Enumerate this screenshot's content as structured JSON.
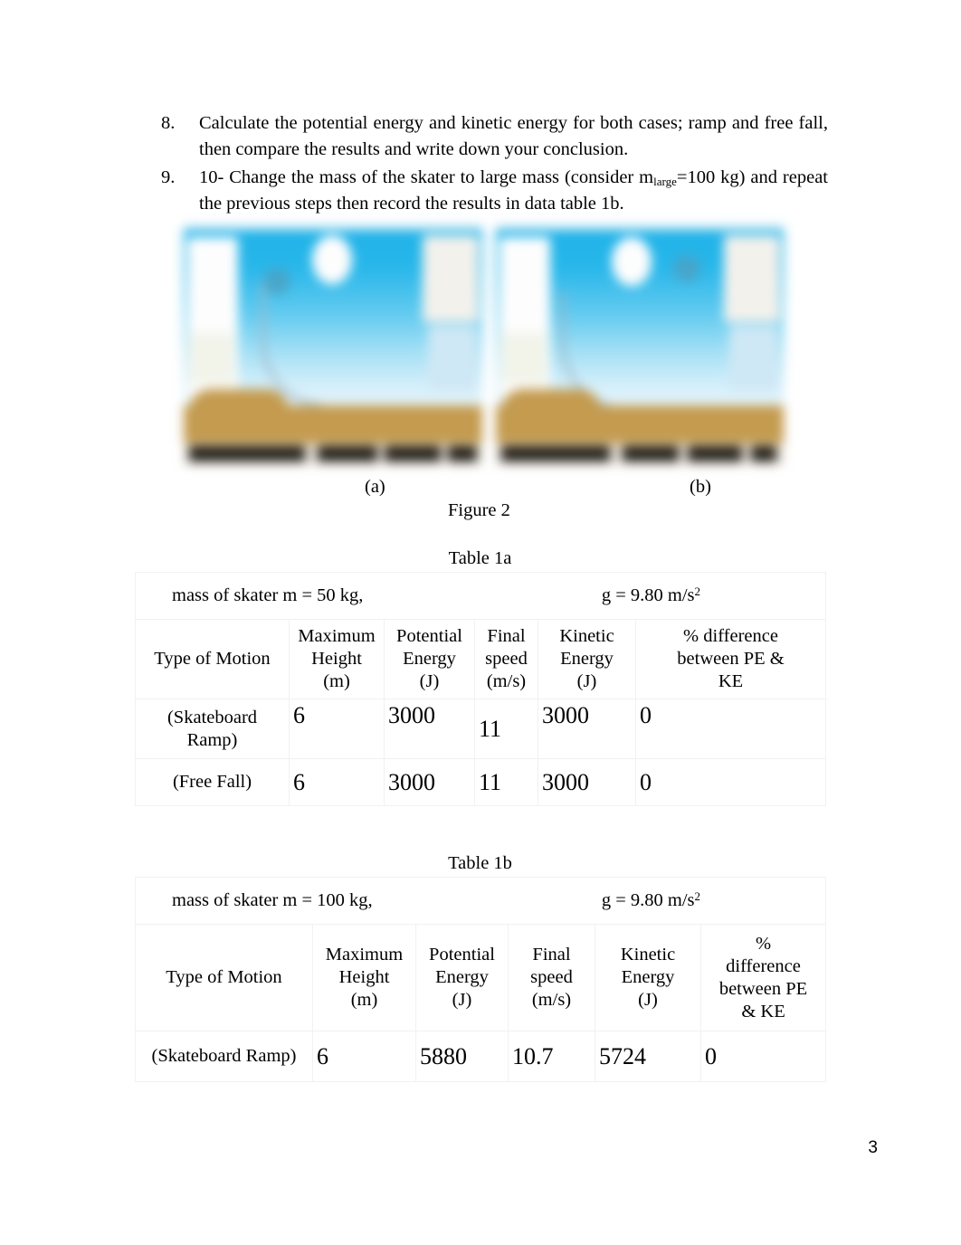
{
  "document": {
    "page_number": "3"
  },
  "list": {
    "items": [
      {
        "marker": "8.",
        "text": "Calculate the potential energy and kinetic energy for both cases; ramp and free fall, then compare the results and write down your conclusion."
      },
      {
        "marker": "9.",
        "text_before": "10- Change the mass of the skater to large mass (consider m",
        "subscript": "large",
        "text_after": "=100 kg) and repeat the previous steps then record the results in data table 1b."
      }
    ]
  },
  "figure": {
    "label_a": "(a)",
    "label_b": "(b)",
    "caption": "Figure 2",
    "colors": {
      "sky": "#1fb2e8",
      "ground": "#c49b4f",
      "control_bar": "#221e18",
      "track": "#9fb6c4"
    }
  },
  "table_1a": {
    "title": "Table 1a",
    "mass_label": "mass of skater m = 50 kg,",
    "gravity_label_base": "g = 9.80 m/s",
    "gravity_exponent": "2",
    "headers": [
      "Type of Motion",
      "Maximum Height (m)",
      "Potential Energy (J)",
      "Final speed (m/s)",
      "Kinetic Energy (J)",
      "% difference between PE & KE"
    ],
    "header_lines": [
      [
        "Type of Motion"
      ],
      [
        "Maximum",
        "Height",
        "(m)"
      ],
      [
        "Potential",
        "Energy",
        "(J)"
      ],
      [
        "Final",
        "speed",
        "(m/s)"
      ],
      [
        "Kinetic",
        "Energy",
        "(J)"
      ],
      [
        "% difference",
        "between PE &",
        "KE"
      ]
    ],
    "rows": [
      {
        "motion_lines": [
          "(Skateboard",
          "Ramp)"
        ],
        "max_height": "6",
        "potential_energy": "3000",
        "final_speed": "11",
        "kinetic_energy": "3000",
        "percent_difference": "0"
      },
      {
        "motion_lines": [
          "(Free Fall)"
        ],
        "max_height": "6",
        "potential_energy": "3000",
        "final_speed": "11",
        "kinetic_energy": "3000",
        "percent_difference": "0"
      }
    ]
  },
  "table_1b": {
    "title": "Table 1b",
    "mass_label": "mass of skater m = 100 kg,",
    "gravity_label_base": "g = 9.80 m/s",
    "gravity_exponent": "2",
    "headers": [
      "Type of Motion",
      "Maximum Height (m)",
      "Potential Energy (J)",
      "Final speed (m/s)",
      "Kinetic Energy (J)",
      "% difference between PE & KE"
    ],
    "header_lines": [
      [
        "Type of Motion"
      ],
      [
        "Maximum",
        "Height",
        "(m)"
      ],
      [
        "Potential",
        "Energy",
        "(J)"
      ],
      [
        "Final",
        "speed",
        "(m/s)"
      ],
      [
        "Kinetic",
        "Energy",
        "(J)"
      ],
      [
        "%",
        "difference",
        "between PE",
        "& KE"
      ]
    ],
    "rows": [
      {
        "motion_lines": [
          "(Skateboard Ramp)"
        ],
        "max_height": "6",
        "potential_energy": "5880",
        "final_speed": "10.7",
        "kinetic_energy": "5724",
        "percent_difference": "0"
      }
    ]
  }
}
